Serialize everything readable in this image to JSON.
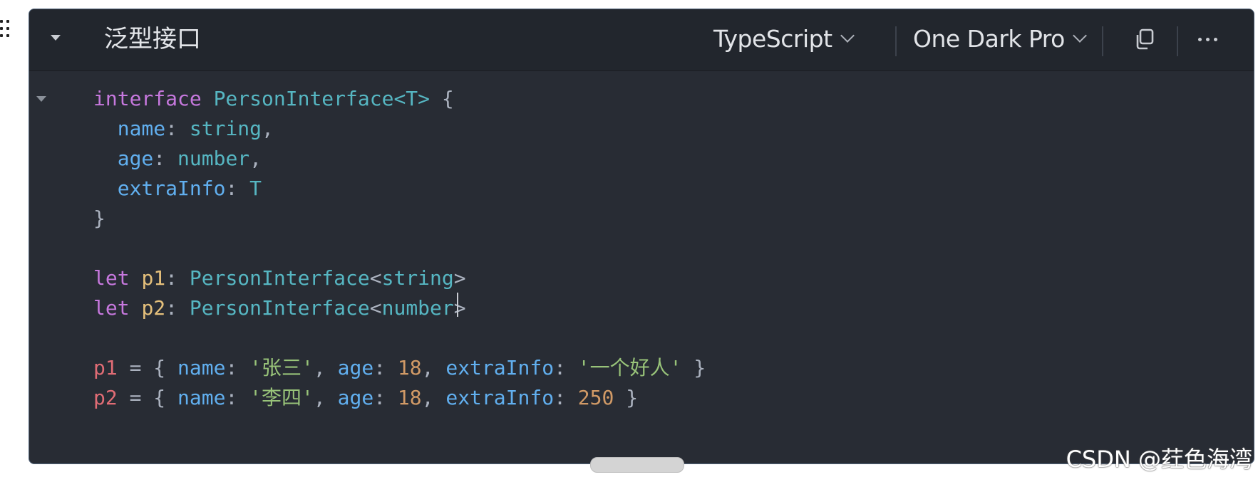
{
  "header": {
    "title": "泛型接口",
    "language": "TypeScript",
    "theme": "One Dark Pro"
  },
  "icons": {
    "drag": "drag-handle-icon",
    "collapse": "caret-down-icon",
    "fold": "fold-caret-icon",
    "copy": "copy-icon",
    "more": "more-horizontal-icon",
    "chevron": "chevron-down-icon"
  },
  "code": {
    "l1": {
      "kw": "interface",
      "name": "PersonInterface",
      "gen": "<T>",
      "brace": " {"
    },
    "l2": {
      "prop": "name",
      "colon": ": ",
      "type": "string",
      "end": ","
    },
    "l3": {
      "prop": "age",
      "colon": ": ",
      "type": "number",
      "end": ","
    },
    "l4": {
      "prop": "extraInfo",
      "colon": ": ",
      "type": "T"
    },
    "l5": {
      "brace": "}"
    },
    "l7": {
      "kw": "let",
      "var": "p1",
      "colon": ": ",
      "type": "PersonInterface",
      "lt": "<",
      "gen": "string",
      "gt": ">"
    },
    "l8": {
      "kw": "let",
      "var": "p2",
      "colon": ": ",
      "type": "PersonInterface",
      "lt": "<",
      "gen": "number",
      "gt": ">"
    },
    "l10": {
      "var": "p1",
      "eq": " = { ",
      "k1": "name",
      "c1": ": ",
      "v1": "'张三'",
      "s1": ", ",
      "k2": "age",
      "c2": ": ",
      "v2": "18",
      "s2": ", ",
      "k3": "extraInfo",
      "c3": ": ",
      "v3": "'一个好人'",
      "end": " }"
    },
    "l11": {
      "var": "p2",
      "eq": " = { ",
      "k1": "name",
      "c1": ": ",
      "v1": "'李四'",
      "s1": ", ",
      "k2": "age",
      "c2": ": ",
      "v2": "18",
      "s2": ", ",
      "k3": "extraInfo",
      "c3": ": ",
      "v3": "250",
      "end": " }"
    }
  },
  "watermark": "CSDN @荭色海湾"
}
